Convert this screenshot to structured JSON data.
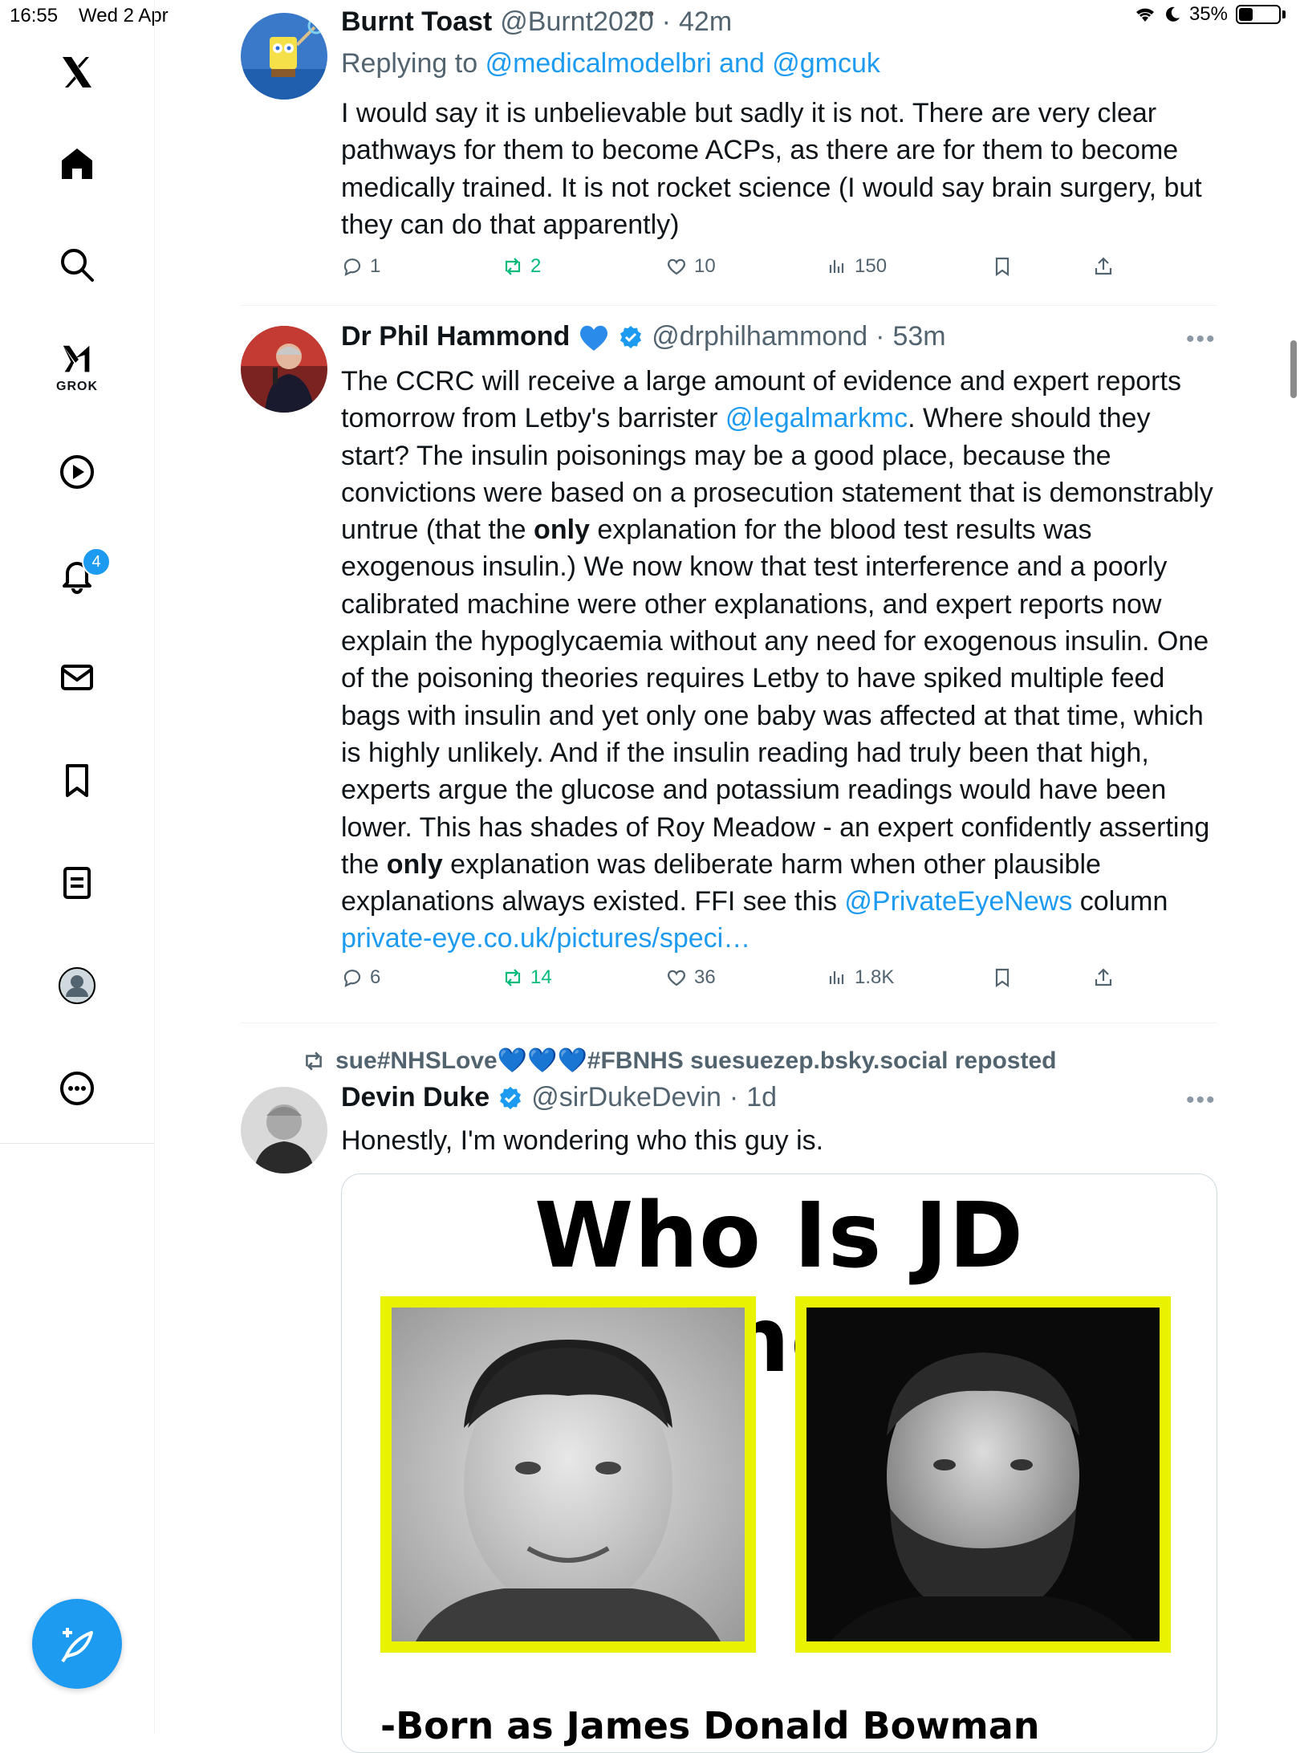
{
  "status_bar": {
    "time": "16:55",
    "date": "Wed 2 Apr",
    "battery": "35%",
    "battery_level": 0.35
  },
  "sidebar": {
    "grok_label": "GROK",
    "notifications_badge": "4",
    "items": [
      "x-logo",
      "home",
      "explore",
      "grok",
      "video",
      "notifications",
      "messages",
      "bookmarks",
      "lists",
      "profile",
      "more"
    ]
  },
  "tweets": [
    {
      "name": "Burnt Toast",
      "handle": "@Burnt2020",
      "time": "42m",
      "replying_prefix": "Replying to",
      "replying_to": "@medicalmodelbri and @gmcuk",
      "text": "I would say it is unbelievable but sadly it is not. There are very clear pathways for them to become ACPs, as there are for them to become medically trained. It is not rocket science (I would say brain surgery, but they can do that apparently)",
      "replies": "1",
      "reposts": "2",
      "likes": "10",
      "views": "150"
    },
    {
      "name": "Dr Phil Hammond",
      "handle": "@drphilhammond",
      "time": "53m",
      "text_parts": {
        "p1": "The CCRC will receive a large amount of evidence and expert reports tomorrow from Letby's barrister ",
        "mention1": "@legalmarkmc",
        "p2": ". Where should they start? The insulin poisonings may be a good place,  because the convictions were based on a prosecution statement that is demonstrably untrue (that the ",
        "bold1": "only",
        "p3": " explanation for the blood test results was exogenous insulin.) We now know that test interference and a poorly calibrated machine were other explanations, and expert reports now explain the hypoglycaemia without any need for exogenous insulin.  One of the poisoning theories requires Letby to have spiked multiple feed bags with insulin and yet only one baby was affected at that time, which is highly unlikely. And if the insulin reading had truly been that high, experts argue the glucose and potassium readings would have been lower.  This has shades of Roy Meadow - an expert confidently asserting the ",
        "bold2": "only",
        "p4": " explanation was deliberate harm when other plausible explanations always existed.  FFI see this ",
        "mention2": "@PrivateEyeNews",
        "p5": " column ",
        "link": "private-eye.co.uk/pictures/speci…"
      },
      "replies": "6",
      "reposts": "14",
      "likes": "36",
      "views": "1.8K"
    },
    {
      "repost_by": "sue#NHSLove💙💙💙#FBNHS suesuezep.bsky.social reposted",
      "name": "Devin Duke",
      "handle": "@sirDukeDevin",
      "time": "1d",
      "text": "Honestly, I'm wondering who this guy is.",
      "media": {
        "title": "Who Is JD Vance?",
        "caption": "-Born as James Donald Bowman"
      }
    }
  ]
}
